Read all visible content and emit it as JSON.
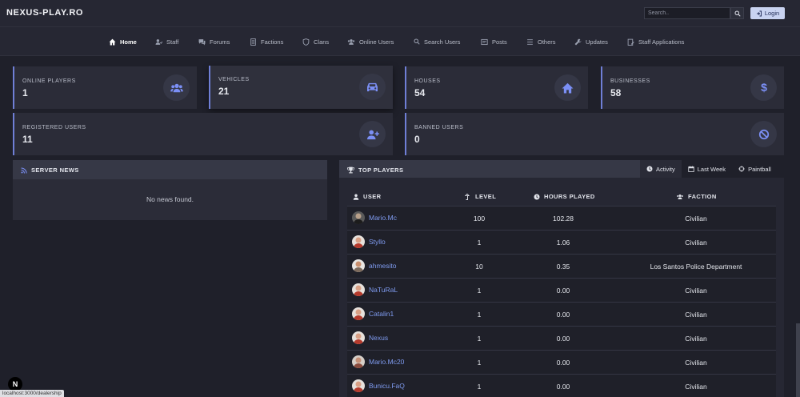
{
  "brand": "NEXUS-PLAY.RO",
  "search": {
    "placeholder": "Search.."
  },
  "login_label": "Login",
  "nav": [
    {
      "label": "Home",
      "icon": "home-icon",
      "active": true
    },
    {
      "label": "Staff",
      "icon": "staff-icon"
    },
    {
      "label": "Forums",
      "icon": "forums-icon"
    },
    {
      "label": "Factions",
      "icon": "factions-icon"
    },
    {
      "label": "Clans",
      "icon": "shield-icon"
    },
    {
      "label": "Online Users",
      "icon": "users-icon"
    },
    {
      "label": "Search Users",
      "icon": "search-icon"
    },
    {
      "label": "Posts",
      "icon": "posts-icon"
    },
    {
      "label": "Others",
      "icon": "list-icon"
    },
    {
      "label": "Updates",
      "icon": "wrench-icon"
    },
    {
      "label": "Staff Applications",
      "icon": "application-icon"
    }
  ],
  "stats": {
    "online_players": {
      "label": "ONLINE PLAYERS",
      "value": "1",
      "icon": "users-icon"
    },
    "vehicles": {
      "label": "VEHICLES",
      "value": "21",
      "icon": "car-icon"
    },
    "houses": {
      "label": "HOUSES",
      "value": "54",
      "icon": "house-icon"
    },
    "businesses": {
      "label": "BUSINESSES",
      "value": "58",
      "icon": "dollar-icon"
    },
    "registered_users": {
      "label": "REGISTERED USERS",
      "value": "11",
      "icon": "user-plus-icon"
    },
    "banned_users": {
      "label": "BANNED USERS",
      "value": "0",
      "icon": "ban-icon"
    }
  },
  "news": {
    "title": "SERVER NEWS",
    "empty_text": "No news found."
  },
  "top_players": {
    "title": "TOP PLAYERS",
    "tabs": [
      {
        "label": "Activity",
        "icon": "clock-icon",
        "active": true
      },
      {
        "label": "Last Week",
        "icon": "calendar-icon"
      },
      {
        "label": "Paintball",
        "icon": "crosshair-icon"
      }
    ],
    "columns": {
      "user": "USER",
      "level": "LEVEL",
      "hours": "HOURS PLAYED",
      "faction": "FACTION"
    },
    "rows": [
      {
        "user": "Mario.Mc",
        "level": "100",
        "hours": "102.28",
        "faction": "Civilian"
      },
      {
        "user": "Styllo",
        "level": "1",
        "hours": "1.06",
        "faction": "Civilian"
      },
      {
        "user": "ahmesito",
        "level": "10",
        "hours": "0.35",
        "faction": "Los Santos Police Department"
      },
      {
        "user": "NaTuRaL",
        "level": "1",
        "hours": "0.00",
        "faction": "Civilian"
      },
      {
        "user": "Catalin1",
        "level": "1",
        "hours": "0.00",
        "faction": "Civilian"
      },
      {
        "user": "Nexus",
        "level": "1",
        "hours": "0.00",
        "faction": "Civilian"
      },
      {
        "user": "Mario.Mc20",
        "level": "1",
        "hours": "0.00",
        "faction": "Civilian"
      },
      {
        "user": "Bunicu.FaQ",
        "level": "1",
        "hours": "0.00",
        "faction": "Civilian"
      }
    ]
  },
  "status_url": "localhost:3000/dealership",
  "next_badge": "N",
  "colors": {
    "accent": "#6f7fd6",
    "link": "#7f9bf0",
    "icon": "#7b8ff5"
  }
}
